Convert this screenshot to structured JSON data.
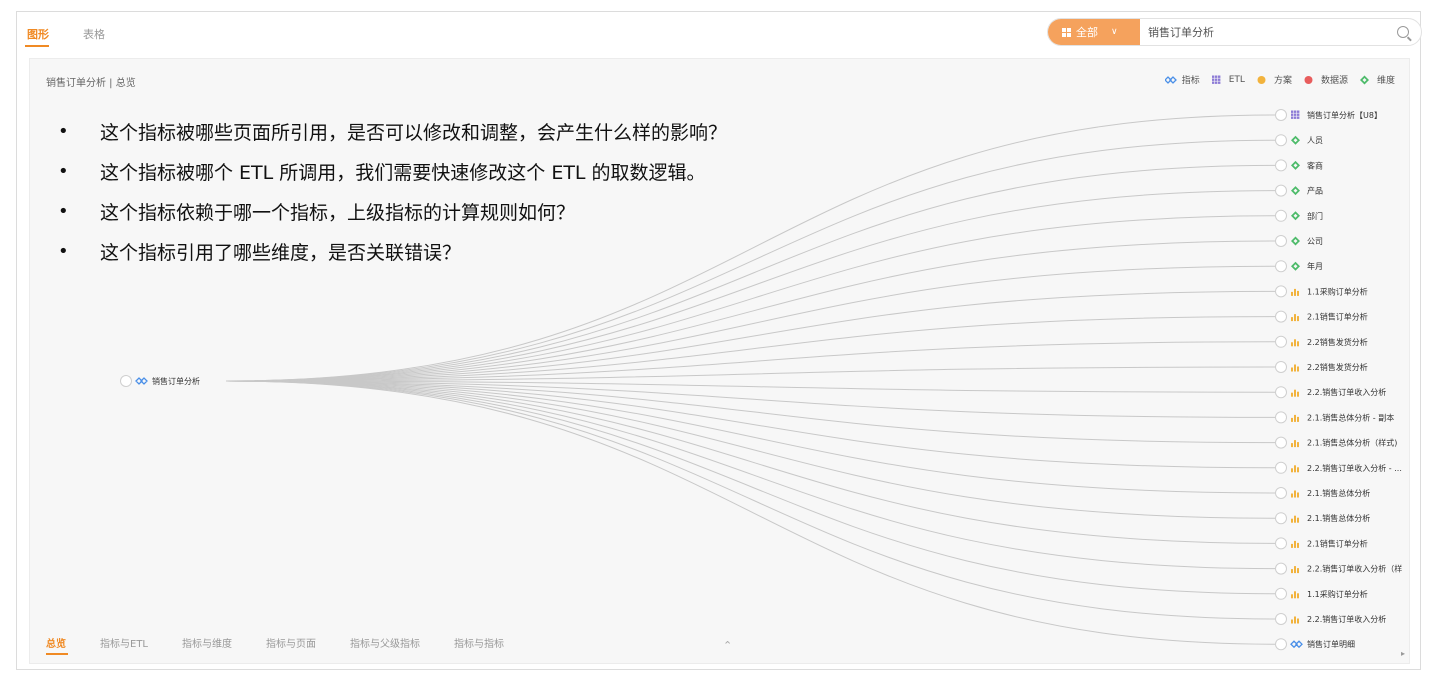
{
  "view_tabs": [
    {
      "label": "图形",
      "active": true
    },
    {
      "label": "表格",
      "active": false
    }
  ],
  "filter": {
    "label": "全部"
  },
  "search": {
    "value": "销售订单分析",
    "placeholder": ""
  },
  "breadcrumb": "销售订单分析 | 总览",
  "legend": [
    {
      "label": "指标",
      "icon": "indicator-icon",
      "color": "#4a8fe8"
    },
    {
      "label": "ETL",
      "icon": "etl-icon",
      "color": "#8e7cd6"
    },
    {
      "label": "方案",
      "icon": "scheme-icon",
      "color": "#f2b33d"
    },
    {
      "label": "数据源",
      "icon": "datasource-icon",
      "color": "#e85d5d"
    },
    {
      "label": "维度",
      "icon": "dimension-icon",
      "color": "#4dbb6a"
    }
  ],
  "bullets": [
    "这个指标被哪些页面所引用，是否可以修改和调整，会产生什么样的影响？",
    "这个指标被哪个 ETL 所调用，我们需要快速修改这个 ETL 的取数逻辑。",
    "这个指标依赖于哪一个指标，上级指标的计算规则如何？",
    "这个指标引用了哪些维度，是否关联错误？"
  ],
  "root": {
    "label": "销售订单分析",
    "type": "indicator"
  },
  "children": [
    {
      "label": "销售订单分析【U8】",
      "type": "etl"
    },
    {
      "label": "人员",
      "type": "dimension"
    },
    {
      "label": "客商",
      "type": "dimension"
    },
    {
      "label": "产品",
      "type": "dimension"
    },
    {
      "label": "部门",
      "type": "dimension"
    },
    {
      "label": "公司",
      "type": "dimension"
    },
    {
      "label": "年月",
      "type": "dimension"
    },
    {
      "label": "1.1采购订单分析",
      "type": "page"
    },
    {
      "label": "2.1销售订单分析",
      "type": "page"
    },
    {
      "label": "2.2销售发货分析",
      "type": "page"
    },
    {
      "label": "2.2销售发货分析",
      "type": "page"
    },
    {
      "label": "2.2.销售订单收入分析",
      "type": "page"
    },
    {
      "label": "2.1.销售总体分析 - 副本",
      "type": "page"
    },
    {
      "label": "2.1.销售总体分析（样式)",
      "type": "page"
    },
    {
      "label": "2.2.销售订单收入分析 - ...",
      "type": "page"
    },
    {
      "label": "2.1.销售总体分析",
      "type": "page"
    },
    {
      "label": "2.1.销售总体分析",
      "type": "page"
    },
    {
      "label": "2.1销售订单分析",
      "type": "page"
    },
    {
      "label": "2.2.销售订单收入分析（样",
      "type": "page"
    },
    {
      "label": "1.1采购订单分析",
      "type": "page"
    },
    {
      "label": "2.2.销售订单收入分析",
      "type": "page"
    },
    {
      "label": "销售订单明细",
      "type": "indicator"
    }
  ],
  "bottom_tabs": [
    {
      "label": "总览",
      "active": true
    },
    {
      "label": "指标与ETL",
      "active": false
    },
    {
      "label": "指标与维度",
      "active": false
    },
    {
      "label": "指标与页面",
      "active": false
    },
    {
      "label": "指标与父级指标",
      "active": false
    },
    {
      "label": "指标与指标",
      "active": false
    }
  ],
  "colors": {
    "accent": "#f08a24",
    "edge": "#c8c8c8"
  }
}
